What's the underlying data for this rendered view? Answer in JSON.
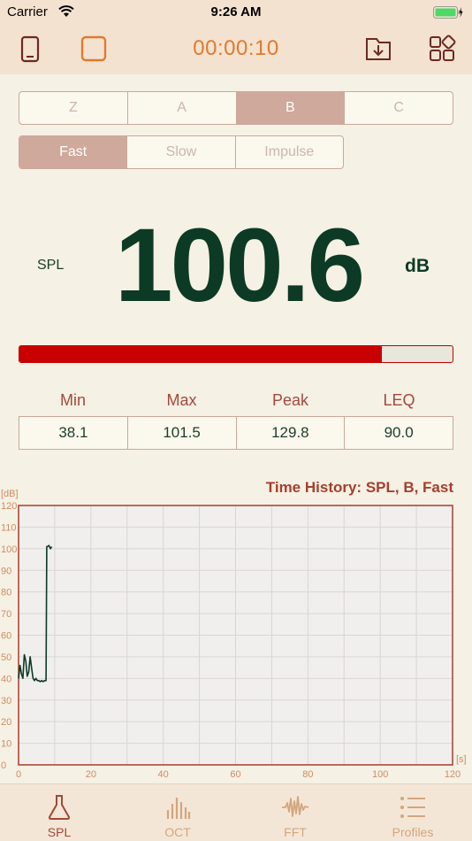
{
  "status": {
    "carrier": "Carrier",
    "time": "9:26 AM"
  },
  "toolbar": {
    "timer": "00:00:10"
  },
  "weighting": {
    "options": [
      "Z",
      "A",
      "B",
      "C"
    ],
    "selected": "B"
  },
  "response": {
    "options": [
      "Fast",
      "Slow",
      "Impulse"
    ],
    "selected": "Fast"
  },
  "meter": {
    "label": "SPL",
    "value": "100.6",
    "unit": "dB",
    "level_fraction": 0.837
  },
  "stats": {
    "headers": [
      "Min",
      "Max",
      "Peak",
      "LEQ"
    ],
    "values": [
      "38.1",
      "101.5",
      "129.8",
      "90.0"
    ]
  },
  "history": {
    "title": "Time History: SPL, B, Fast"
  },
  "colors": {
    "accent": "#e07a2e",
    "level": "#c90000",
    "trace": "#0c3a25",
    "frame": "#a53f2e"
  },
  "chart_data": {
    "type": "line",
    "title": "Time History: SPL, B, Fast",
    "ylabel": "[dB]",
    "xlabel": "[s]",
    "xlim": [
      0,
      120
    ],
    "ylim": [
      0,
      120
    ],
    "xticks": [
      0,
      20,
      40,
      60,
      80,
      100,
      120
    ],
    "yticks": [
      0,
      10,
      20,
      30,
      40,
      50,
      60,
      70,
      80,
      90,
      100,
      110,
      120
    ],
    "grid": true,
    "series": [
      {
        "x": [
          0,
          0.4,
          0.8,
          1.2,
          1.6,
          2.0,
          2.4,
          2.8,
          3.2,
          3.6,
          4.0,
          4.4,
          4.8,
          5.2,
          5.6,
          6.0,
          6.4,
          6.8,
          7.2,
          7.6,
          7.8,
          8.0,
          8.4,
          8.8,
          9.2
        ],
        "y": [
          40,
          46,
          42,
          40,
          51,
          48,
          41,
          43,
          50,
          45,
          40,
          39,
          40,
          39,
          39,
          38.5,
          39,
          38.5,
          39,
          39,
          101,
          101,
          101.5,
          100,
          101
        ]
      }
    ]
  },
  "tabs": [
    {
      "label": "SPL",
      "icon": "flask-icon",
      "active": true
    },
    {
      "label": "OCT",
      "icon": "octave-bars-icon",
      "active": false
    },
    {
      "label": "FFT",
      "icon": "waveform-icon",
      "active": false
    },
    {
      "label": "Profiles",
      "icon": "list-icon",
      "active": false
    }
  ]
}
